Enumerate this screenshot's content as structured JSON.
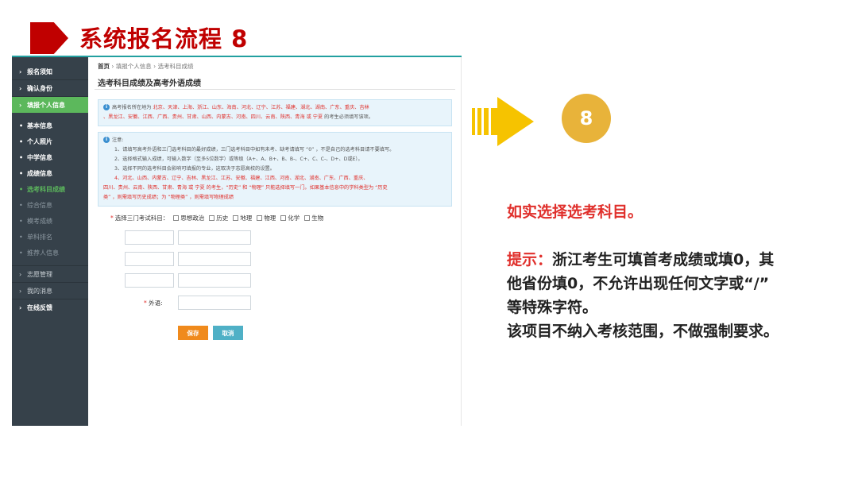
{
  "slide": {
    "title": "系统报名流程 8",
    "step_number": "8",
    "instruction": "如实选择选考科目。",
    "tip_label": "提示：",
    "tip_line1": "浙江考生可填首考成绩或填0，其",
    "tip_line2": "他省份填0，不允许出现任何文字或“/”",
    "tip_line3": "等特殊字符。",
    "tip_line4": "该项目不纳入考核范围，不做强制要求。"
  },
  "sidebar": {
    "items": [
      {
        "mark": "›",
        "label": "报名须知"
      },
      {
        "mark": "›",
        "label": "确认身份"
      },
      {
        "mark": "›",
        "label": "填报个人信息"
      },
      {
        "mark": "•",
        "label": "基本信息"
      },
      {
        "mark": "•",
        "label": "个人照片"
      },
      {
        "mark": "•",
        "label": "中学信息"
      },
      {
        "mark": "•",
        "label": "成绩信息"
      },
      {
        "mark": "•",
        "label": "选考科目成绩"
      },
      {
        "mark": "•",
        "label": "综合信息"
      },
      {
        "mark": "•",
        "label": "模考成绩"
      },
      {
        "mark": "•",
        "label": "单科排名"
      },
      {
        "mark": "•",
        "label": "推荐人信息"
      },
      {
        "mark": "›",
        "label": "志愿管理"
      },
      {
        "mark": "›",
        "label": "我的消息"
      },
      {
        "mark": "›",
        "label": "在线反馈"
      }
    ]
  },
  "content": {
    "breadcrumb_home": "首页",
    "breadcrumb_sep": "›",
    "breadcrumb_2": "填报个人信息",
    "breadcrumb_3": "选考科目成绩",
    "heading": "选考科目成绩及高考外语成绩",
    "notice1_prefix": "高考报名所在地为",
    "notice1_regions1": "北京、天津、上海、浙江、山东、海南、河北、辽宁、江苏、福建、湖北、湖南、广东、重庆、吉林",
    "notice1_regions2": "、黑龙江、安徽、江西、广西、贵州、甘肃、山西、内蒙古、河南、四川、云南、陕西、青海 或 宁夏",
    "notice1_suffix": " 的考生必须填写该项。",
    "notice2_title": "注意:",
    "notice2_l1": "1、请填写高考外语和三门选考科目的最好成绩，三门选考科目中如有未考、缺考请填写 “0” ，不是自己的选考科目请不要填写。",
    "notice2_l2": "2、选择格式输入成绩，可输入数字（至多5位数字）或等级（A+、A、B+、B、B-、C+、C、C-、D+、D或E）。",
    "notice2_l3": "3、选择不同的选考科目会影响可填报的专业，这取决于志愿高校的设置。",
    "notice2_l4": "4、河北、山西、内蒙古、辽宁、吉林、黑龙江、江苏、安徽、福建、江西、河南、湖北、湖南、广东、广西、重庆、",
    "notice2_l5": "四川、贵州、云南、陕西、甘肃、青海 或 宁夏 的考生，“历史” 和 “物理” 只能选择填写一门。如果基本信息中的学科类型为 “历史",
    "notice2_l6": "类” ，则需填写历史成绩；为 “物理类” ，则需填写物理成绩",
    "subject_label": "选择三门考试科目：",
    "subjects": [
      "思想政治",
      "历史",
      "地理",
      "物理",
      "化学",
      "生物"
    ],
    "foreign_label": "外语:",
    "save_label": "保存",
    "cancel_label": "取消"
  },
  "colors": {
    "accent_red": "#c00000",
    "sidebar_bg": "#36414a",
    "active_green": "#5cb85c",
    "step_circle": "#e8b33a",
    "save_orange": "#f08a1c",
    "cancel_blue": "#4fb0c6"
  }
}
